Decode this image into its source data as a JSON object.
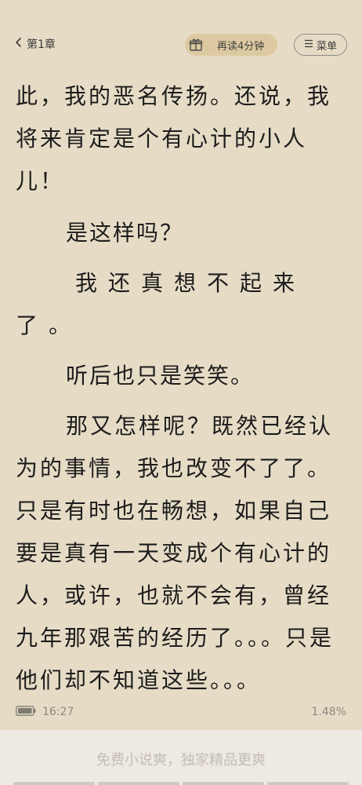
{
  "header": {
    "back_label": "第1章",
    "timer_label": "再读4分钟",
    "menu_label": "菜单"
  },
  "content": {
    "paragraphs": [
      "此，我的恶名传扬。还说，我将来肯定是个有心计的小人儿！",
      "是这样吗？",
      "我还真想不起来了。",
      "听后也只是笑笑。",
      "那又怎样呢？既然已经认为的事情，我也改变不了了。只是有时也在畅想，如果自己要是真有一天变成个有心计的人，或许，也就不会有，曾经九年那艰苦的经历了。。。只是他们却不知道这些。。。"
    ]
  },
  "status": {
    "time": "16:27",
    "progress": "1.48%"
  },
  "banner": {
    "text": "免费小说爽，独家精品更爽"
  },
  "colors": {
    "page_bg": "#e6dcc6",
    "timer_bg": "#ddc9a1",
    "text": "#1c1c1c",
    "muted": "#8b877e"
  },
  "icons": [
    "chevron-left-icon",
    "gift-icon",
    "menu-lines-icon",
    "battery-icon"
  ]
}
